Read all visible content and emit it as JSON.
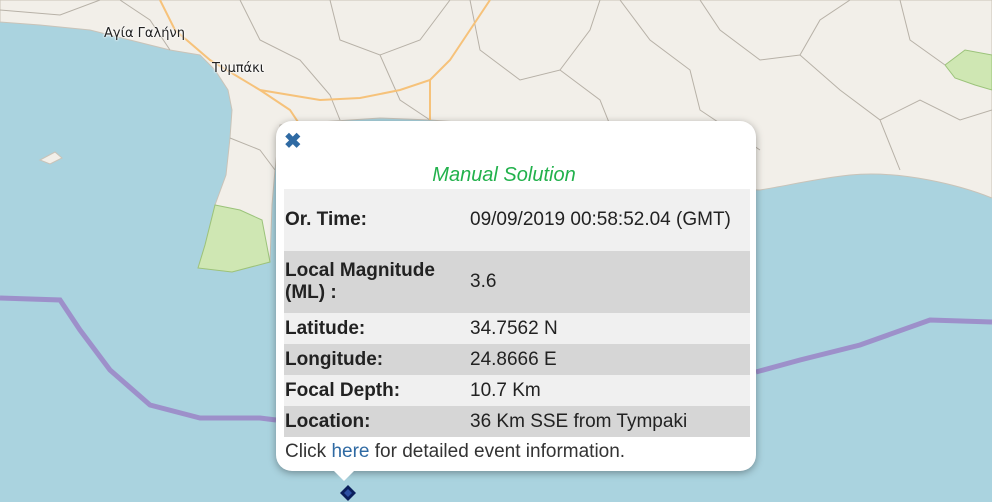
{
  "map": {
    "colors": {
      "sea": "#aad3df",
      "land": "#f2efe9",
      "boundary_line": "#9b84c7",
      "road": "#f6c27a",
      "green_area": "#cfe7b3"
    },
    "places": [
      {
        "id": "agia-galini",
        "label": "Αγία Γαλήνη"
      },
      {
        "id": "tympaki",
        "label": "Τυμπάκι"
      }
    ]
  },
  "popup": {
    "close_icon": "close-icon",
    "title": "Manual Solution",
    "rows": [
      {
        "key": "Or. Time:",
        "value": "09/09/2019 00:58:52.04 (GMT)"
      },
      {
        "key": "Local Magnitude (ML) :",
        "value": "3.6"
      },
      {
        "key": "Latitude:",
        "value": "34.7562 N"
      },
      {
        "key": "Longitude:",
        "value": "24.8666 E"
      },
      {
        "key": "Focal Depth:",
        "value": "10.7 Km"
      },
      {
        "key": "Location:",
        "value": "36 Km SSE from Tympaki"
      }
    ],
    "footer": {
      "prefix": "Click",
      "link_text": "here",
      "suffix": "for detailed event information."
    }
  },
  "marker_icon": "earthquake-marker-icon"
}
